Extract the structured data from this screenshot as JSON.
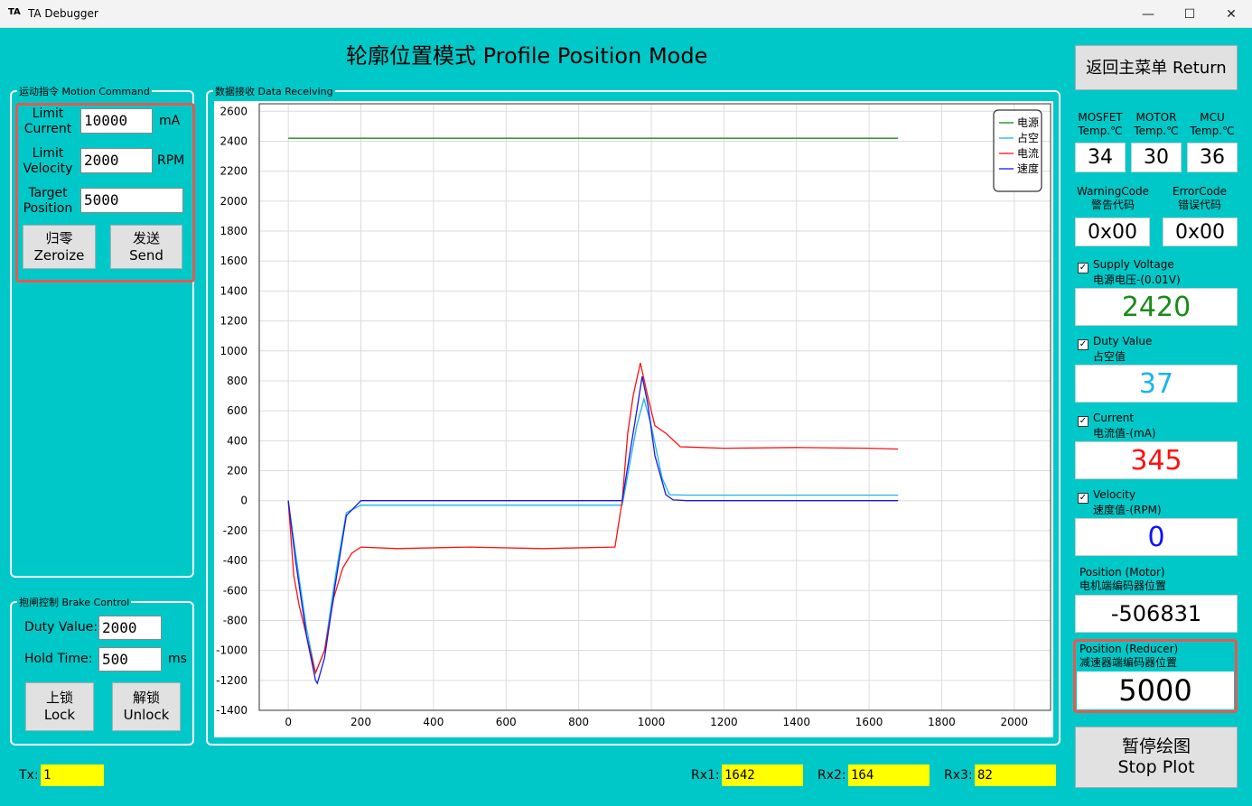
{
  "window": {
    "app_icon": "TA",
    "title": "TA Debugger",
    "minimize": "—",
    "maximize": "☐",
    "close": "✕"
  },
  "heading": "轮廓位置模式 Profile Position Mode",
  "return_button": "返回主菜单 Return",
  "motion": {
    "group_label": "运动指令 Motion Command",
    "limit_current_label": [
      "Limit",
      "Current"
    ],
    "limit_current_value": "10000",
    "limit_current_unit": "mA",
    "limit_velocity_label": [
      "Limit",
      "Velocity"
    ],
    "limit_velocity_value": "2000",
    "limit_velocity_unit": "RPM",
    "target_position_label": [
      "Target",
      "Position"
    ],
    "target_position_value": "5000",
    "zeroize_button": [
      "归零",
      "Zeroize"
    ],
    "send_button": [
      "发送",
      "Send"
    ]
  },
  "brake": {
    "group_label": "抱闸控制 Brake Control",
    "duty_label": "Duty Value:",
    "duty_value": "2000",
    "hold_label": "Hold  Time:",
    "hold_value": "500",
    "hold_unit": "ms",
    "lock_button": [
      "上锁",
      "Lock"
    ],
    "unlock_button": [
      "解锁",
      "Unlock"
    ]
  },
  "data_group_label": "数据接收 Data Receiving",
  "temps": [
    {
      "label": [
        "MOSFET",
        "Temp.℃"
      ],
      "value": "34"
    },
    {
      "label": [
        "MOTOR",
        "Temp.℃"
      ],
      "value": "30"
    },
    {
      "label": [
        "MCU",
        "Temp.℃"
      ],
      "value": "36"
    }
  ],
  "codes": [
    {
      "label": [
        "WarningCode",
        "警告代码"
      ],
      "value": "0x00"
    },
    {
      "label": [
        "ErrorCode",
        "错误代码"
      ],
      "value": "0x00"
    }
  ],
  "readouts": [
    {
      "label": [
        "Supply Voltage",
        "电源电压-(0.01V)"
      ],
      "value": "2420",
      "color": "#1a8a1a"
    },
    {
      "label": [
        "Duty Value",
        "占空值"
      ],
      "value": "37",
      "color": "#19b4f0"
    },
    {
      "label": [
        "Current",
        "电流值-(mA)"
      ],
      "value": "345",
      "color": "#ff1010"
    },
    {
      "label": [
        "Velocity",
        "速度值-(RPM)"
      ],
      "value": "0",
      "color": "#1010ff"
    }
  ],
  "position_motor": {
    "label": [
      "Position (Motor)",
      "电机端编码器位置"
    ],
    "value": "-506831"
  },
  "position_reducer": {
    "label": [
      "Position (Reducer)",
      "减速器端编码器位置"
    ],
    "value": "5000"
  },
  "stop_plot_button": [
    "暂停绘图",
    "Stop Plot"
  ],
  "status": {
    "tx_label": "Tx:",
    "tx_value": "1",
    "rx1_label": "Rx1:",
    "rx1_value": "1642",
    "rx2_label": "Rx2:",
    "rx2_value": "164",
    "rx3_label": "Rx3:",
    "rx3_value": "82"
  },
  "colors": {
    "background": "#00C8C8",
    "highlight": "#e8584f",
    "status_field": "#ffff00"
  },
  "chart_data": {
    "type": "line",
    "xlim": [
      -80,
      2100
    ],
    "ylim": [
      -1400,
      2650
    ],
    "x_ticks": [
      0,
      200,
      400,
      600,
      800,
      1000,
      1200,
      1400,
      1600,
      1800,
      2000
    ],
    "y_ticks": [
      2600,
      2400,
      2200,
      2000,
      1800,
      1600,
      1400,
      1200,
      1000,
      800,
      600,
      400,
      200,
      0,
      -200,
      -400,
      -600,
      -800,
      -1000,
      -1200,
      -1400
    ],
    "grid": true,
    "legend_position": "top-right",
    "series": [
      {
        "name": "电源",
        "color": "#1a8a1a",
        "x": [
          0,
          100,
          200,
          300,
          400,
          500,
          600,
          700,
          800,
          900,
          950,
          1000,
          1100,
          1200,
          1300,
          1400,
          1500,
          1600,
          1680
        ],
        "y": [
          2420,
          2420,
          2420,
          2420,
          2420,
          2420,
          2420,
          2420,
          2420,
          2420,
          2420,
          2420,
          2420,
          2420,
          2420,
          2420,
          2420,
          2420,
          2420
        ]
      },
      {
        "name": "占空",
        "color": "#19b4f0",
        "x": [
          0,
          20,
          50,
          75,
          100,
          130,
          160,
          200,
          500,
          920,
          960,
          980,
          1000,
          1030,
          1050,
          1100,
          1300,
          1680
        ],
        "y": [
          0,
          -350,
          -850,
          -1150,
          -1000,
          -500,
          -80,
          -30,
          -30,
          -30,
          500,
          680,
          500,
          150,
          40,
          37,
          37,
          37
        ]
      },
      {
        "name": "电流",
        "color": "#ff1010",
        "x": [
          0,
          15,
          30,
          50,
          75,
          100,
          125,
          150,
          175,
          200,
          300,
          500,
          700,
          900,
          920,
          935,
          950,
          970,
          990,
          1010,
          1040,
          1080,
          1200,
          1400,
          1600,
          1680
        ],
        "y": [
          0,
          -500,
          -700,
          -900,
          -1150,
          -1000,
          -650,
          -450,
          -350,
          -310,
          -320,
          -310,
          -320,
          -310,
          0,
          450,
          700,
          920,
          700,
          500,
          450,
          360,
          350,
          355,
          350,
          345
        ]
      },
      {
        "name": "速度",
        "color": "#1a1adc",
        "x": [
          0,
          20,
          50,
          75,
          80,
          100,
          130,
          160,
          200,
          500,
          920,
          960,
          975,
          990,
          1010,
          1040,
          1060,
          1100,
          1300,
          1680
        ],
        "y": [
          0,
          -400,
          -900,
          -1200,
          -1220,
          -1050,
          -550,
          -100,
          0,
          0,
          0,
          600,
          830,
          650,
          300,
          40,
          5,
          0,
          0,
          0
        ]
      }
    ]
  }
}
